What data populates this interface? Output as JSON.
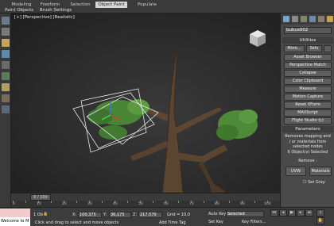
{
  "ribbon": {
    "tabs": [
      "Modeling",
      "Freeform",
      "Selection",
      "Object Paint",
      "Populate"
    ],
    "active_tab": "Object Paint",
    "subtabs": [
      "Paint Objects",
      "Brush Settings"
    ]
  },
  "viewport": {
    "label": "[+] [Perspective] [Realistic]"
  },
  "command_panel": {
    "object_name": "bubus002",
    "utilities_header": "Utilities",
    "more_button": "More...",
    "sets_button": "Sets",
    "utility_buttons": [
      "Asset Browser",
      "Perspective Match",
      "Collapse",
      "Color Clipboard",
      "Measure",
      "Motion Capture",
      "Reset XForm",
      "MAXScript",
      "Flight Studio (c)"
    ],
    "parameters_header": "Parameters",
    "parameters_text": "Removes mapping and / or materials from selected nodes",
    "selected_count": "6 Object(s) Selected",
    "remove_label": "Remove :",
    "uvw_button": "UVW",
    "materials_button": "Materials",
    "set_gray_label": "Set Gray"
  },
  "timeline": {
    "frame_display": "0 / 100",
    "ruler_ticks": [
      "0",
      "10",
      "20",
      "30",
      "40",
      "50",
      "60",
      "70",
      "80",
      "90",
      "100"
    ]
  },
  "status": {
    "maxscript_text": "Welcome to M",
    "selected_label": "1 Ob",
    "x_label": "X:",
    "x_value": "100,375",
    "y_label": "Y:",
    "y_value": "36,175",
    "z_label": "Z:",
    "z_value": "217,570",
    "grid_label": "Grid = 10,0",
    "prompt": "Click and drag to select and move objects",
    "add_time_tag": "Add Time Tag",
    "autokey": "Auto Key",
    "setkey": "Set Key",
    "selected_dropdown": "Selected",
    "key_filters": "Key Filters..."
  }
}
